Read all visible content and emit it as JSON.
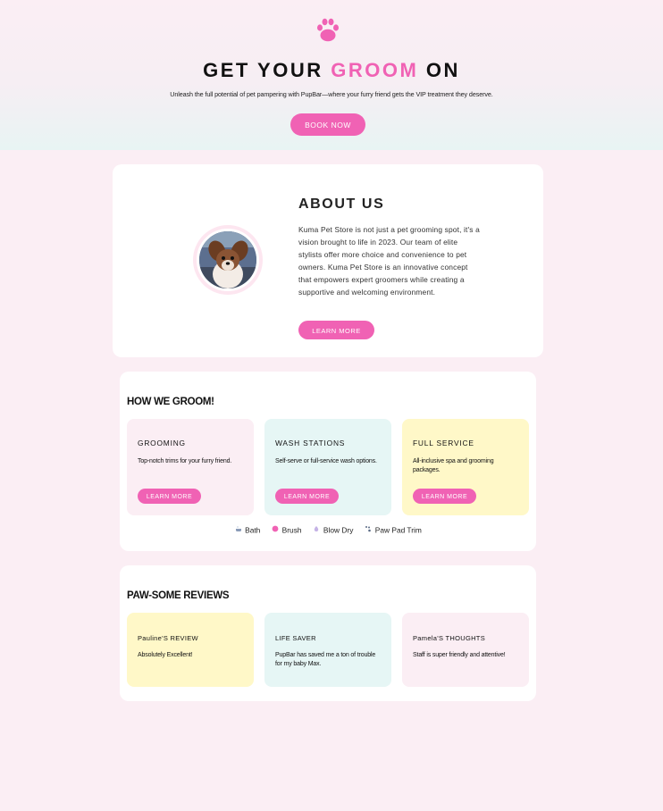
{
  "hero": {
    "title_part1": "GET YOUR ",
    "title_accent": "GROOM",
    "title_part2": " ON",
    "subtitle": "Unleash the full potential of pet pampering with PupBar—where your furry friend gets the VIP treatment they deserve.",
    "book_label": "BOOK NOW",
    "logo_icon": "paw-icon"
  },
  "about": {
    "title": "ABOUT US",
    "body": "Kuma Pet Store is not just a pet grooming spot, it's a vision brought to life in 2023. Our team of elite stylists offer more choice and convenience to pet owners. Kuma Pet Store is an innovative concept that empowers expert groomers while creating a supportive and welcoming environment.",
    "button_label": "LEARN MORE",
    "photo_icon": "dog-photo"
  },
  "groom": {
    "title": "HOW WE GROOM!",
    "cards": [
      {
        "title": "GROOMING",
        "text": "Top-notch trims for your furry friend.",
        "button_label": "LEARN MORE"
      },
      {
        "title": "WASH STATIONS",
        "text": "Self-serve or full-service wash options.",
        "button_label": "LEARN MORE"
      },
      {
        "title": "FULL SERVICE",
        "text": "All-inclusive spa and grooming packages.",
        "button_label": "LEARN MORE"
      }
    ],
    "services": [
      {
        "icon": "bath-icon",
        "label": "Bath"
      },
      {
        "icon": "brush-icon",
        "label": "Brush"
      },
      {
        "icon": "blow-dry-icon",
        "label": "Blow Dry"
      },
      {
        "icon": "paw-pad-icon",
        "label": "Paw Pad Trim"
      }
    ]
  },
  "reviews": {
    "title": "PAW-SOME REVIEWS",
    "cards": [
      {
        "title": "Pauline'S REVIEW",
        "text": "Absolutely Excellent!"
      },
      {
        "title": "LIFE SAVER",
        "text": "PupBar has saved me a ton of trouble for my baby Max."
      },
      {
        "title": "Pamela'S THOUGHTS",
        "text": "Staff is super friendly and attentive!"
      }
    ]
  },
  "colors": {
    "accent": "#f062b4",
    "background": "#fbeef4",
    "card_pink": "#fbeef4",
    "card_mint": "#e6f6f5",
    "card_yellow": "#fff8c8"
  }
}
